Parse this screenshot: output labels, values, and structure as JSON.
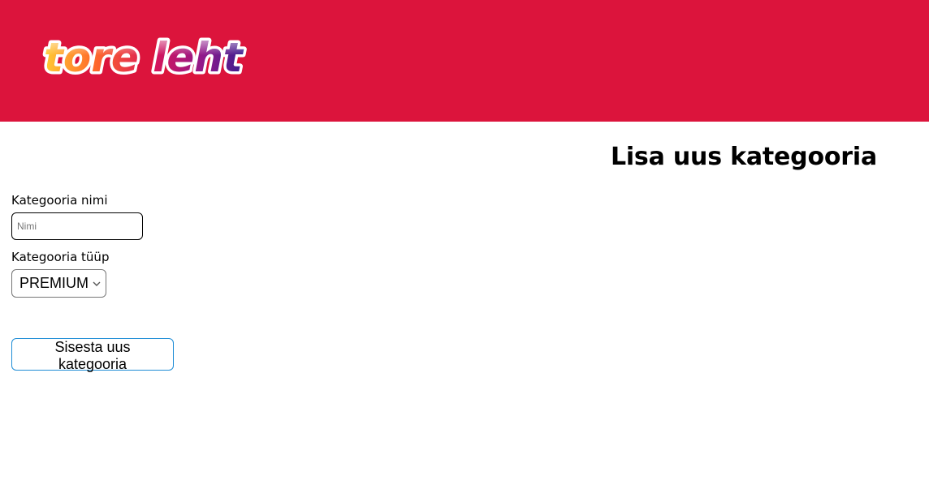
{
  "header": {
    "background_color": "#dc143c",
    "logo_text": "tore leht"
  },
  "page": {
    "title": "Lisa uus kategooria"
  },
  "form": {
    "name_label": "Kategooria nimi",
    "name_placeholder": "Nimi",
    "name_value": "",
    "type_label": "Kategooria tüüp",
    "type_selected": "PREMIUM",
    "submit_label": "Sisesta uus kategooria",
    "accent_color": "#1f8dd6"
  }
}
